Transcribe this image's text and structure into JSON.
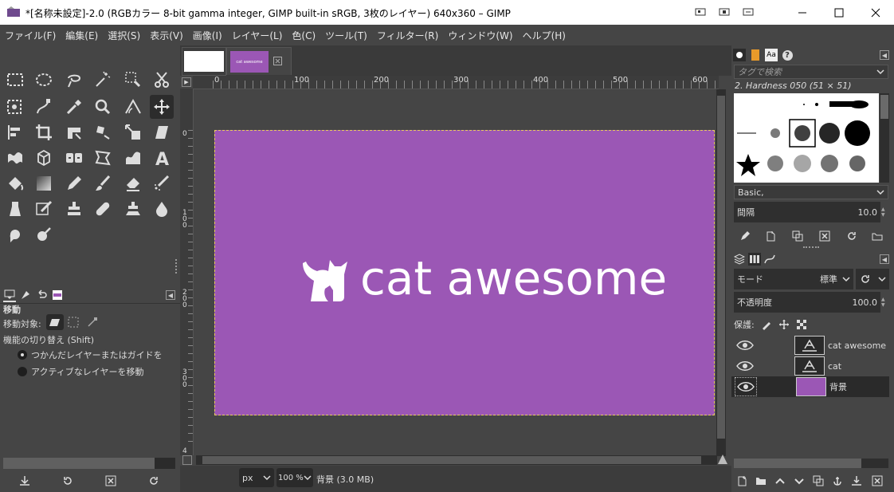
{
  "window": {
    "title": "*[名称未設定]-2.0 (RGBカラー 8-bit gamma integer, GIMP built-in sRGB, 3枚のレイヤー) 640x360 – GIMP"
  },
  "menu": [
    "ファイル(F)",
    "編集(E)",
    "選択(S)",
    "表示(V)",
    "画像(I)",
    "レイヤー(L)",
    "色(C)",
    "ツール(T)",
    "フィルター(R)",
    "ウィンドウ(W)",
    "ヘルプ(H)"
  ],
  "colors": {
    "foreground": "#ffffff",
    "background": "#9b57b5",
    "canvas": "#9b57b5",
    "selection": "#e7c960"
  },
  "tool_options": {
    "title": "移動",
    "move_label": "移動対象:",
    "toggle_label": "機能の切り替え  (Shift)",
    "radio1": "つかんだレイヤーまたはガイドを",
    "radio2": "アクティブなレイヤーを移動"
  },
  "ruler": {
    "top": [
      "0",
      "100",
      "200",
      "300",
      "400",
      "500",
      "600"
    ],
    "left": [
      "0",
      "100",
      "200",
      "300",
      "4"
    ]
  },
  "canvas": {
    "text": "cat awesome"
  },
  "thumb": {
    "text": "cat awesome"
  },
  "status": {
    "unit": "px",
    "zoom": "100 %",
    "info": "背景 (3.0 MB)"
  },
  "brushes": {
    "tag_placeholder": "タグで検索",
    "current": "2. Hardness 050 (51 × 51)",
    "preset": "Basic,",
    "spacing_label": "間隔",
    "spacing_value": "10.0"
  },
  "layers": {
    "mode_label": "モード",
    "mode_value": "標準",
    "opacity_label": "不透明度",
    "opacity_value": "100.0",
    "lock_label": "保護:",
    "items": [
      {
        "name": "cat awesome",
        "type": "text"
      },
      {
        "name": "cat",
        "type": "text"
      },
      {
        "name": "背景",
        "type": "image"
      }
    ]
  }
}
